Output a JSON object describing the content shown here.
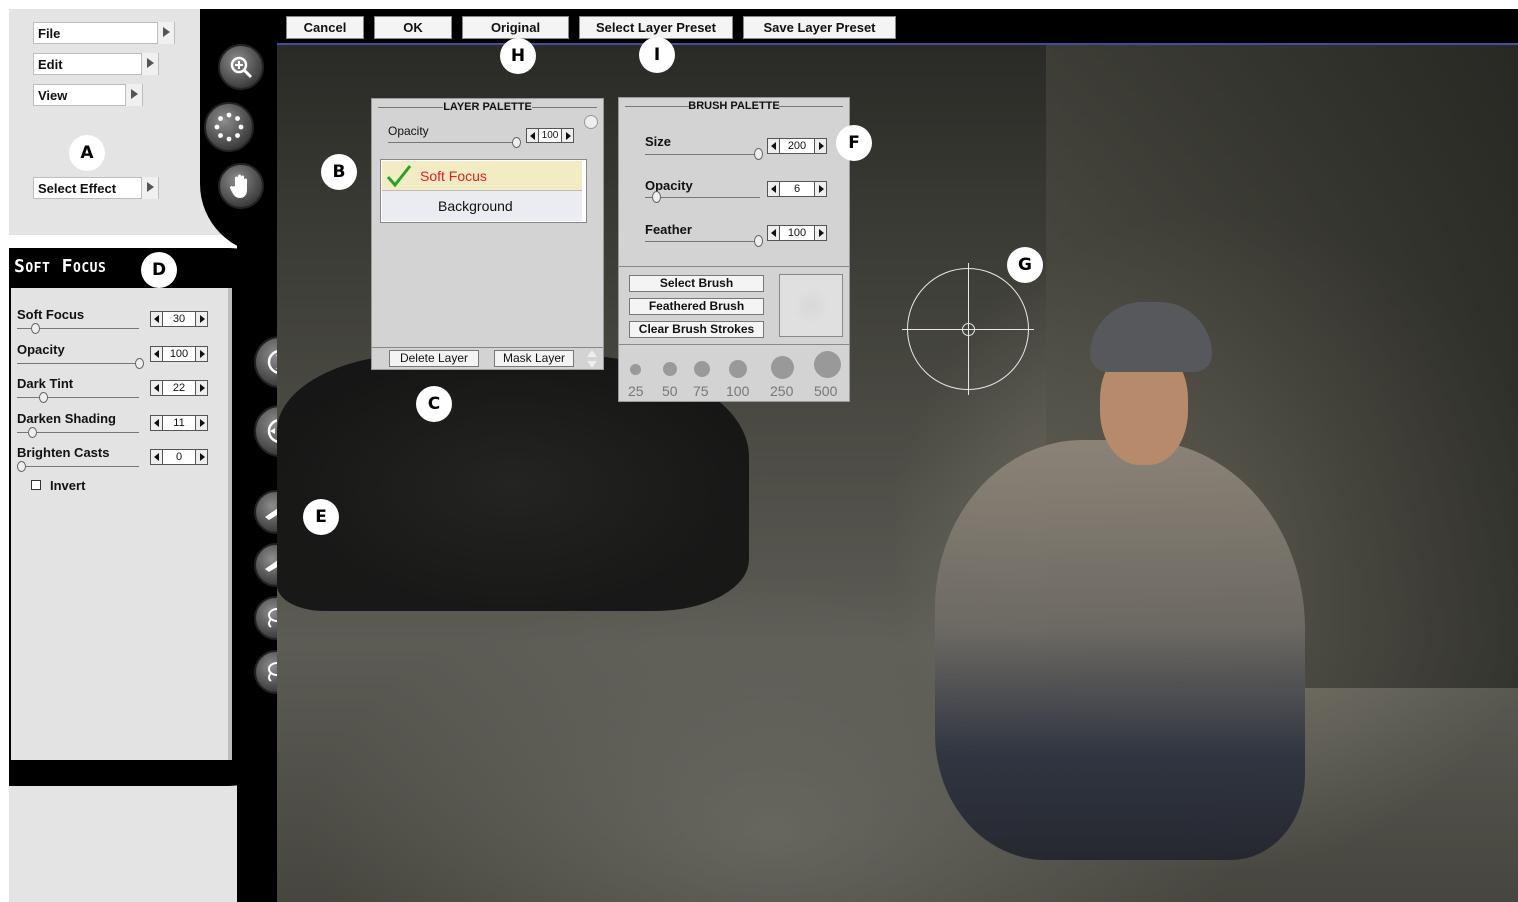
{
  "menu": {
    "file": "File",
    "edit": "Edit",
    "view": "View",
    "select_effect": "Select Effect"
  },
  "tools": {
    "zoom": "zoom-icon",
    "selection": "dotted-circle-icon",
    "hand": "hand-icon"
  },
  "effect": {
    "title": "Soft Focus",
    "sliders": [
      {
        "label": "Soft Focus",
        "value": "30"
      },
      {
        "label": "Opacity",
        "value": "100"
      },
      {
        "label": "Dark Tint",
        "value": "22"
      },
      {
        "label": "Darken Shading",
        "value": "11"
      },
      {
        "label": "Brighten Casts",
        "value": "0"
      }
    ],
    "invert_label": "Invert"
  },
  "toolbar": {
    "cancel": "Cancel",
    "ok": "OK",
    "original": "Original",
    "select_layer_preset": "Select Layer Preset",
    "save_layer_preset": "Save Layer Preset"
  },
  "layer_palette": {
    "title": "LAYER PALETTE",
    "opacity_label": "Opacity",
    "opacity_value": "100",
    "layers": [
      "Soft Focus",
      "Background"
    ],
    "delete_layer": "Delete Layer",
    "mask_layer": "Mask Layer"
  },
  "brush_palette": {
    "title": "BRUSH PALETTE",
    "size_label": "Size",
    "size_value": "200",
    "opacity_label": "Opacity",
    "opacity_value": "6",
    "feather_label": "Feather",
    "feather_value": "100",
    "select_brush": "Select Brush",
    "feathered_brush": "Feathered Brush",
    "clear_brush_strokes": "Clear Brush Strokes",
    "sizes": [
      "25",
      "50",
      "75",
      "100",
      "250",
      "500"
    ]
  },
  "badges": [
    "A",
    "B",
    "C",
    "D",
    "E",
    "F",
    "G",
    "H",
    "I"
  ],
  "colors": {
    "active_layer_text": "#e02020",
    "active_layer_bg": "#f1ecc4",
    "checkmark": "#2aa02a"
  }
}
